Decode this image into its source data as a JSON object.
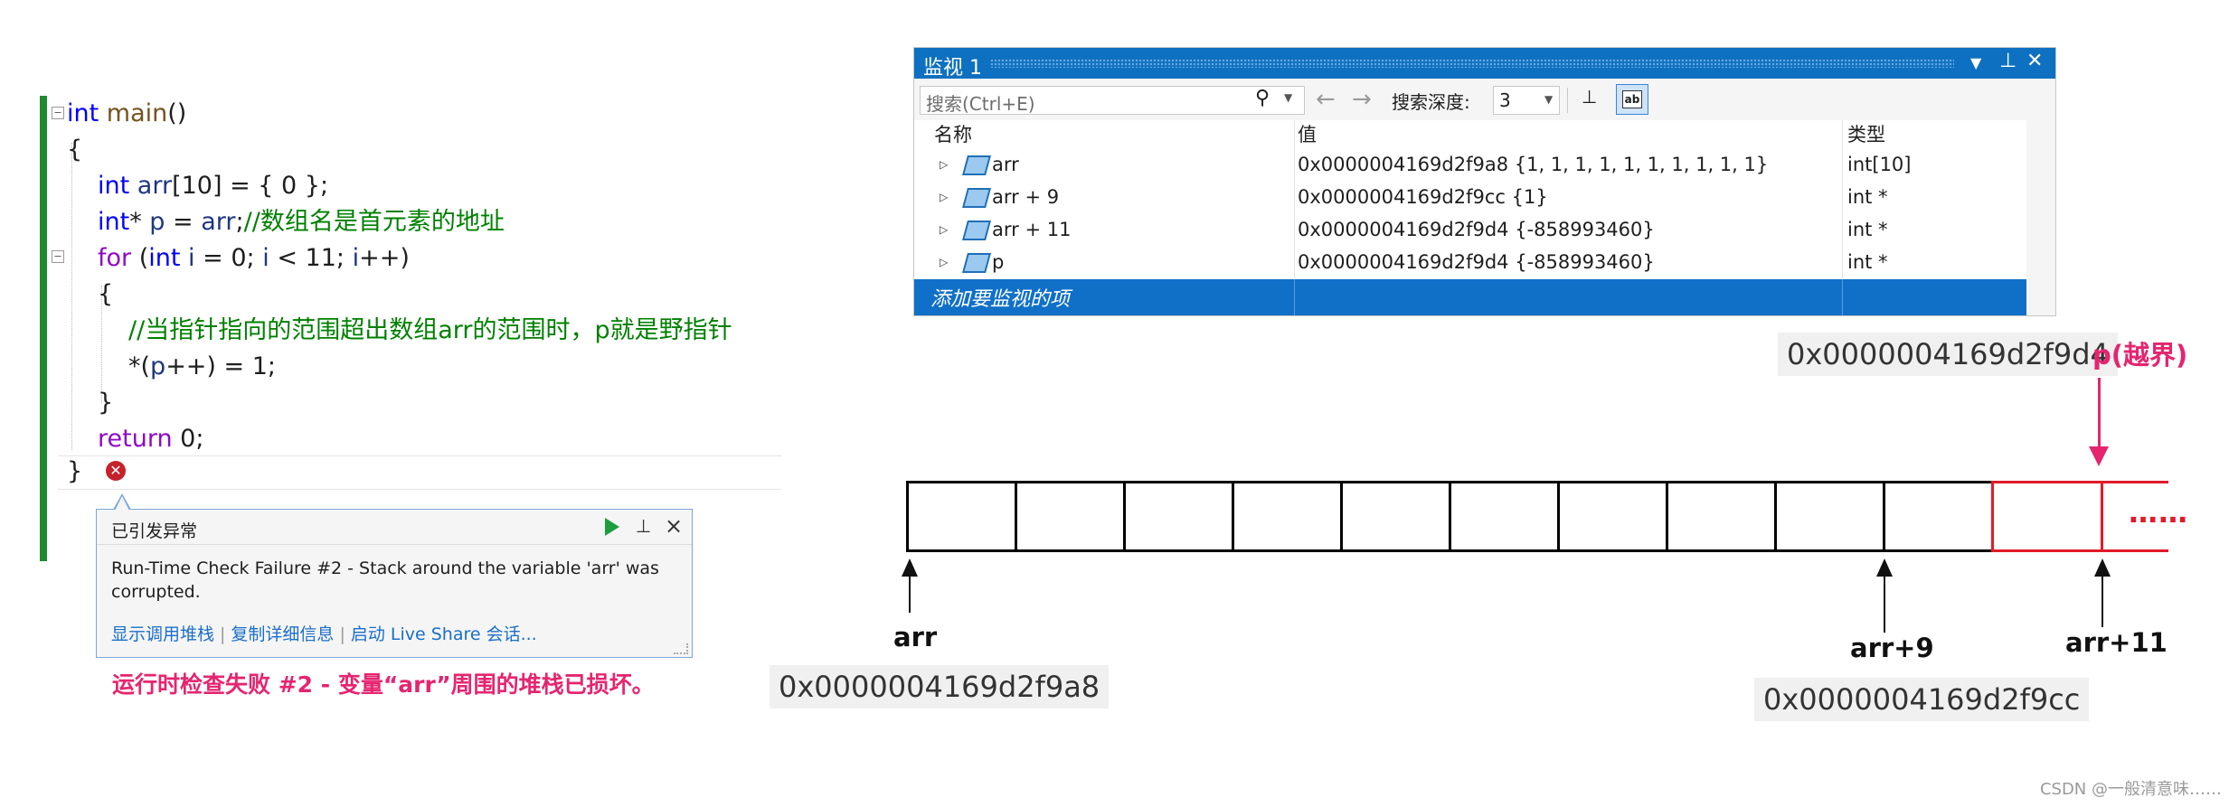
{
  "editor": {
    "lines": {
      "l1": {
        "kw": "int",
        "fn": "main",
        "rest": "()"
      },
      "l2": "{",
      "l3": {
        "kw": "int",
        "var": "arr",
        "rest": "[10] = { 0 };"
      },
      "l4": {
        "kw": "int",
        "rest1": "* ",
        "var": "p",
        "rest2": " = ",
        "var2": "arr",
        "rest3": ";",
        "comment": "//数组名是首元素的地址"
      },
      "l5": {
        "ctl": "for",
        "rest1": " (",
        "kw": "int",
        "rest2": " ",
        "var": "i",
        "rest3": " = 0; ",
        "var2": "i",
        "rest4": " < 11; ",
        "var3": "i",
        "rest5": "++)"
      },
      "l6": "{",
      "l7": "//当指针指向的范围超出数组arr的范围时，p就是野指针",
      "l8": {
        "rest1": "*(",
        "var": "p",
        "rest2": "++) = 1;"
      },
      "l9": "}",
      "l10": {
        "ctl": "return",
        "rest": " 0;"
      },
      "l11": "}"
    },
    "error_icon": "error-x-icon"
  },
  "exception": {
    "title": "已引发异常",
    "message": "Run-Time Check Failure #2 - Stack around the variable 'arr' was corrupted.",
    "links": [
      "显示调用堆栈",
      "复制详细信息",
      "启动 Live Share 会话..."
    ],
    "translation": "运行时检查失败 #2 - 变量“arr”周围的堆栈已损坏。"
  },
  "watch": {
    "title": "监视 1",
    "search_placeholder": "搜索(Ctrl+E)",
    "depth_label": "搜索深度:",
    "depth_value": "3",
    "columns": [
      "名称",
      "值",
      "类型"
    ],
    "rows": [
      {
        "name": "arr",
        "value": "0x0000004169d2f9a8 {1, 1, 1, 1, 1, 1, 1, 1, 1, 1}",
        "type": "int[10]"
      },
      {
        "name": "arr + 9",
        "value": "0x0000004169d2f9cc {1}",
        "type": "int *"
      },
      {
        "name": "arr + 11",
        "value": "0x0000004169d2f9d4 {-858993460}",
        "type": "int *"
      },
      {
        "name": "p",
        "value": "0x0000004169d2f9d4 {-858993460}",
        "type": "int *"
      }
    ],
    "add_item": "添加要监视的项"
  },
  "diagram": {
    "addr_arr": "0x0000004169d2f9a8",
    "addr_arr9": "0x0000004169d2f9cc",
    "addr_p": "0x0000004169d2f9d4",
    "label_arr": "arr",
    "label_arr9": "arr+9",
    "label_arr11": "arr+11",
    "label_p": "p(越界)",
    "ellipsis": "……",
    "cell_border": "#000000",
    "overflow_border": "#e11b2a",
    "accent_pink": "#e5256f"
  },
  "footer": "CSDN @一般清意味……"
}
